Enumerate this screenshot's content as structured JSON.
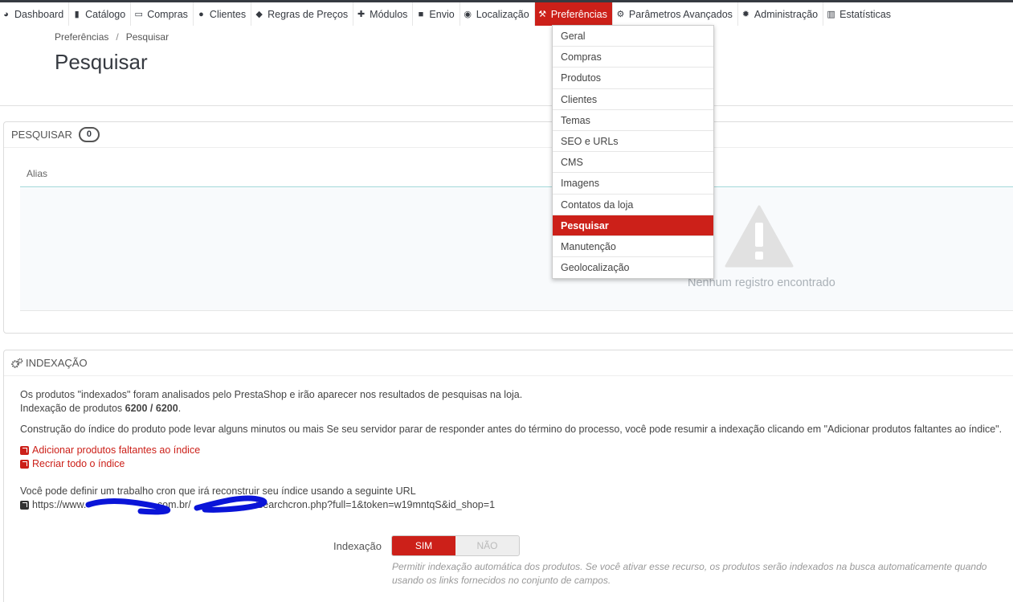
{
  "nav": [
    {
      "label": "Dashboard",
      "icon": "dashboard-icon"
    },
    {
      "label": "Catálogo",
      "icon": "book-icon"
    },
    {
      "label": "Compras",
      "icon": "credit-card-icon"
    },
    {
      "label": "Clientes",
      "icon": "users-icon"
    },
    {
      "label": "Regras de Preços",
      "icon": "tag-icon"
    },
    {
      "label": "Módulos",
      "icon": "puzzle-icon"
    },
    {
      "label": "Envio",
      "icon": "truck-icon"
    },
    {
      "label": "Localização",
      "icon": "globe-icon"
    },
    {
      "label": "Preferências",
      "icon": "wrench-icon"
    },
    {
      "label": "Parâmetros Avançados",
      "icon": "cogs-icon"
    },
    {
      "label": "Administração",
      "icon": "gear-icon"
    },
    {
      "label": "Estatísticas",
      "icon": "bar-chart-icon"
    }
  ],
  "dropdown": [
    "Geral",
    "Compras",
    "Produtos",
    "Clientes",
    "Temas",
    "SEO e URLs",
    "CMS",
    "Imagens",
    "Contatos da loja",
    "Pesquisar",
    "Manutenção",
    "Geolocalização"
  ],
  "breadcrumb": {
    "parent": "Preferências",
    "separator": "/",
    "current": "Pesquisar"
  },
  "page_title": "Pesquisar",
  "search_panel": {
    "title": "PESQUISAR",
    "count": "0",
    "column": "Alias",
    "empty_text": "Nenhum registro encontrado"
  },
  "index_panel": {
    "title": "INDEXAÇÃO",
    "intro": "Os produtos \"indexados\" foram analisados pelo PrestaShop e irão aparecer nos resultados de pesquisas na loja.",
    "count_label": "Indexação de produtos ",
    "count_value": "6200 / 6200",
    "count_suffix": ".",
    "note": "Construção do índice do produto pode levar alguns minutos ou mais Se seu servidor parar de responder antes do término do processo, você pode resumir a indexação clicando em \"Adicionar produtos faltantes ao índice\".",
    "link_add": "Adicionar produtos faltantes ao índice",
    "link_rebuild": "Recriar todo o índice",
    "cron_text": "Você pode definir um trabalho cron que irá reconstruir seu índice usando a seguinte URL",
    "cron_url_start": "https://www.",
    "cron_url_mid": ".com.br/",
    "cron_url_end": "/searchcron.php?full=1&token=w19mntqS&id_shop=1",
    "field_label": "Indexação",
    "yes": "SIM",
    "no": "NÃO",
    "help": "Permitir indexação automática dos produtos. Se você ativar esse recurso, os produtos serão indexados na busca automaticamente quando usando os links fornecidos no conjunto de campos."
  },
  "colors": {
    "accent": "#cc2019",
    "dark": "#363a41"
  }
}
